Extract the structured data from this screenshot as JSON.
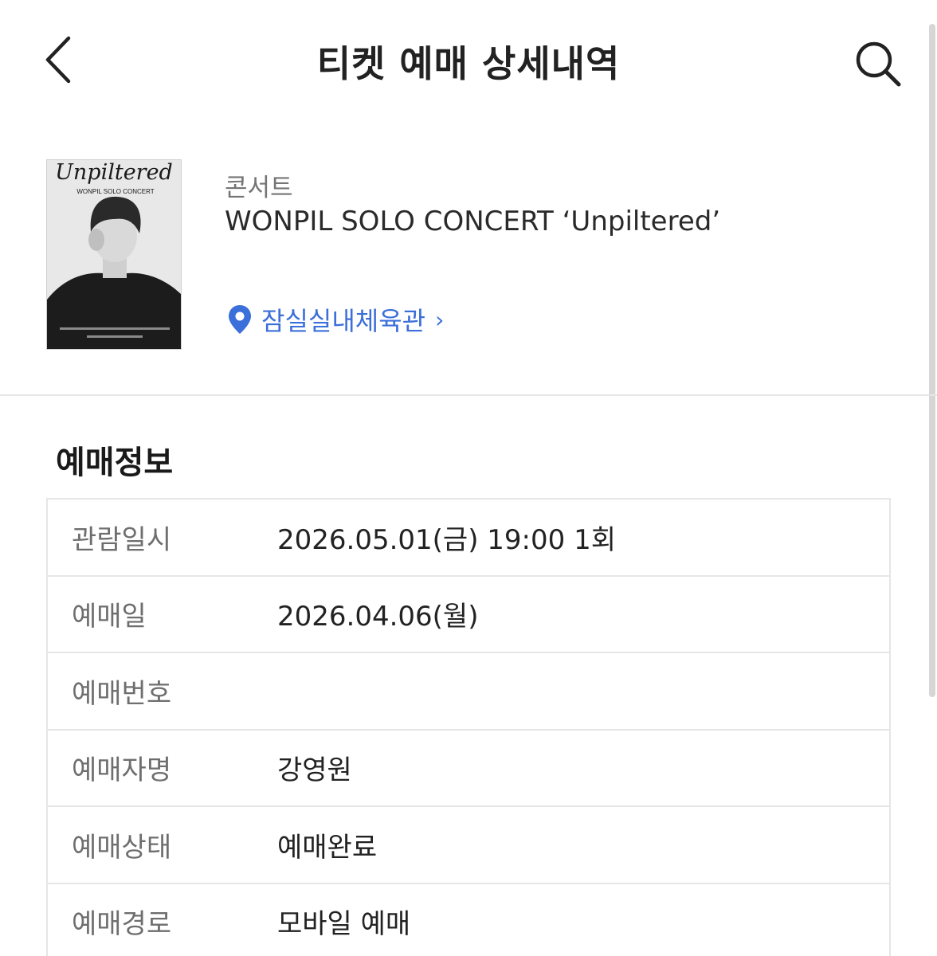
{
  "header": {
    "title": "티켓 예매 상세내역",
    "back_icon": "chevron-left-icon",
    "search_icon": "search-icon"
  },
  "event": {
    "category": "콘서트",
    "title": "WONPIL SOLO CONCERT ‘Unpiltered’",
    "venue": "잠실실내체육관",
    "venue_chevron": "›",
    "poster": {
      "script_title": "Unpiltered",
      "subtitle": "WONPIL SOLO CONCERT"
    }
  },
  "booking_info": {
    "heading": "예매정보",
    "rows": [
      {
        "label": "관람일시",
        "value": "2026.05.01(금) 19:00 1회"
      },
      {
        "label": "예매일",
        "value": "2026.04.06(월)"
      },
      {
        "label": "예매번호",
        "value": ""
      },
      {
        "label": "예매자명",
        "value": "강영원"
      },
      {
        "label": "예매상태",
        "value": "예매완료"
      },
      {
        "label": "예매경로",
        "value": "모바일 예매"
      }
    ]
  },
  "colors": {
    "accent": "#3b6fd9",
    "label_text": "#6e6e6e",
    "border": "#e6e6e6"
  }
}
